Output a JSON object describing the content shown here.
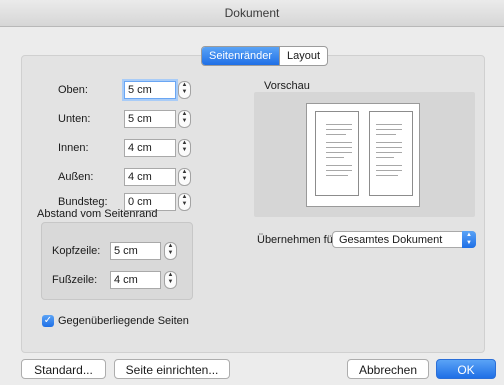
{
  "window": {
    "title": "Dokument"
  },
  "tabs": [
    {
      "label": "Seitenränder",
      "active": true
    },
    {
      "label": "Layout",
      "active": false
    }
  ],
  "margins": {
    "top": {
      "label": "Oben:",
      "value": "5 cm"
    },
    "bottom": {
      "label": "Unten:",
      "value": "5 cm"
    },
    "inner": {
      "label": "Innen:",
      "value": "4 cm"
    },
    "outer": {
      "label": "Außen:",
      "value": "4 cm"
    },
    "gutter": {
      "label": "Bundsteg:",
      "value": "0 cm"
    }
  },
  "from_edge": {
    "title": "Abstand vom Seitenrand",
    "header": {
      "label": "Kopfzeile:",
      "value": "5 cm"
    },
    "footer": {
      "label": "Fußzeile:",
      "value": "4 cm"
    }
  },
  "preview": {
    "title": "Vorschau"
  },
  "apply_to": {
    "label": "Übernehmen für:",
    "value": "Gesamtes Dokument"
  },
  "mirror_margins": {
    "label": "Gegenüberliegende Seiten",
    "checked": true
  },
  "buttons": {
    "default": "Standard...",
    "page_setup": "Seite einrichten...",
    "cancel": "Abbrechen",
    "ok": "OK"
  },
  "colors": {
    "accent": "#2f80ed",
    "panel": "#e3e3e3",
    "window": "#ececec"
  }
}
